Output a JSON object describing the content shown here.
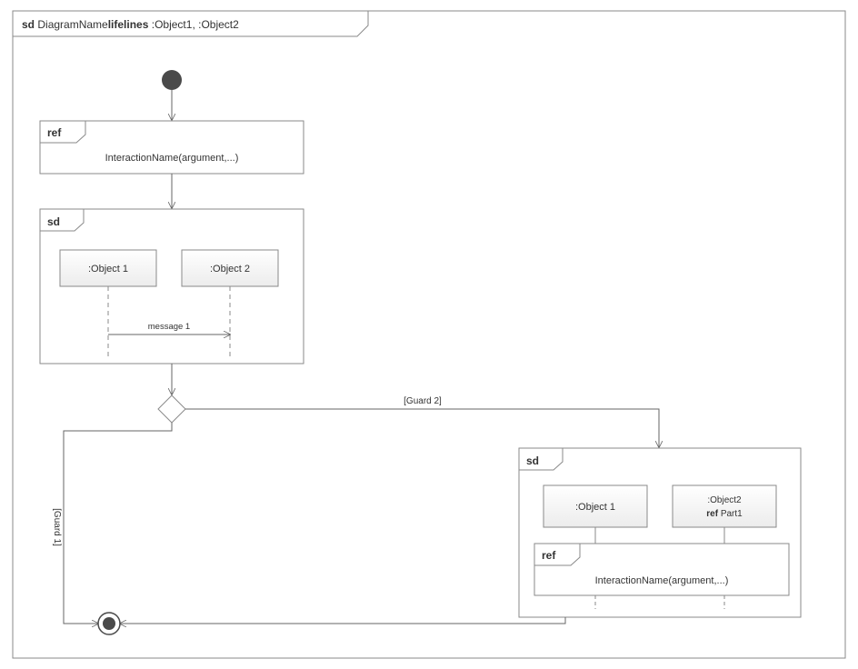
{
  "frame": {
    "tag_prefix": "sd",
    "diagram_name": "DiagramName",
    "lifelines_label": "lifelines",
    "lifelines_list": ":Object1, :Object2"
  },
  "ref1": {
    "tag": "ref",
    "content": "InteractionName(argument,...)"
  },
  "sd1": {
    "tag": "sd",
    "object1": ":Object 1",
    "object2": ":Object 2",
    "message": "message 1"
  },
  "decision": {
    "guard1": "[Guard 1]",
    "guard2": "[Guard 2]"
  },
  "sd2": {
    "tag": "sd",
    "object1": ":Object 1",
    "object2_line1": ":Object2",
    "object2_ref": "ref",
    "object2_part": " Part1",
    "inner_ref_tag": "ref",
    "inner_ref_content": "InteractionName(argument,...)"
  }
}
